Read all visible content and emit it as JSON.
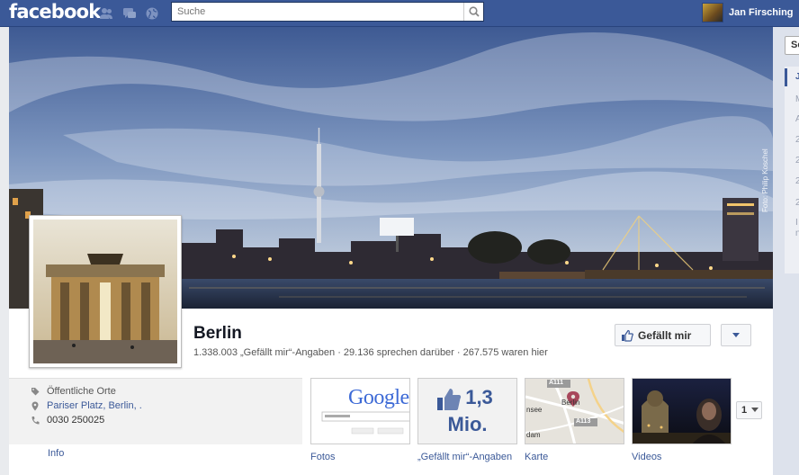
{
  "topbar": {
    "logo": "facebook",
    "search_placeholder": "Suche",
    "user_name": "Jan Firsching"
  },
  "page": {
    "name": "Berlin",
    "stats": "1.338.003 „Gefällt mir“-Angaben · 29.136 sprechen darüber · 267.575 waren hier",
    "cover_credit": "Foto: Philip Koschel",
    "like_button": "Gefällt mir"
  },
  "about": {
    "category": "Öffentliche Orte",
    "address": "Pariser Platz, Berlin, .",
    "phone": "0030 250025",
    "info_label": "Info"
  },
  "tiles": {
    "photos_label": "Fotos",
    "photo_google_text": "Google",
    "likes_count_line1": "1,3",
    "likes_count_line2": "Mio.",
    "likes_label": "„Gefällt mir“-Angaben",
    "map_label": "Karte",
    "map_road_a111": "A111",
    "map_road_a113": "A113",
    "map_city": "Berlin",
    "map_fragment_1": "nsee",
    "map_fragment_2": "dam",
    "videos_label": "Videos",
    "more_count": "1"
  },
  "sidebar": {
    "top_fragment": "Se",
    "items": [
      "J",
      "M",
      "A",
      "2",
      "2",
      "2",
      "2",
      "I",
      "n"
    ]
  },
  "colors": {
    "brand": "#3b5998",
    "sky_top": "#3e5a93",
    "sky_bottom": "#b7c5d9"
  }
}
